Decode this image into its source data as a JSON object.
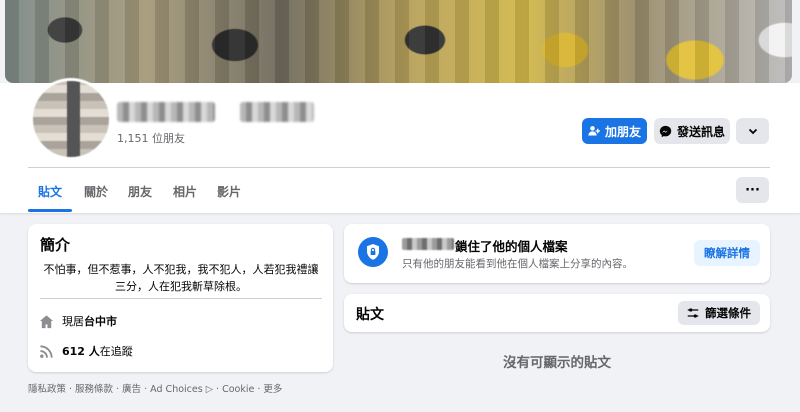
{
  "profile": {
    "friend_count": "1,151 位朋友",
    "add_friend_label": "加朋友",
    "message_label": "發送訊息"
  },
  "tabs": [
    "貼文",
    "關於",
    "朋友",
    "相片",
    "影片"
  ],
  "more_tab_label": "···",
  "intro": {
    "title": "簡介",
    "bio": "不怕事，但不惹事，人不犯我，我不犯人，人若犯我禮讓三分，人在犯我斬草除根。",
    "lives_prefix": "現居",
    "lives_city": "台中市",
    "followers": "612 人",
    "followers_suffix": "在追蹤"
  },
  "lock_notice": {
    "title": "鎖住了他的個人檔案",
    "subtitle": "只有他的朋友能看到他在個人檔案上分享的內容。",
    "learn_more_label": "瞭解詳情"
  },
  "posts": {
    "title": "貼文",
    "filter_label": "篩選條件",
    "empty_text": "沒有可顯示的貼文"
  },
  "footer": "隱私政策 · 服務條款 · 廣告 · Ad Choices ▷ · Cookie · 更多",
  "colors": {
    "accent": "#1b74e4",
    "background": "#f0f2f5"
  },
  "icons": [
    "add-friend-icon",
    "messenger-icon",
    "chevron-down-icon",
    "lock-shield-icon",
    "home-icon",
    "rss-icon",
    "filter-sliders-icon"
  ]
}
